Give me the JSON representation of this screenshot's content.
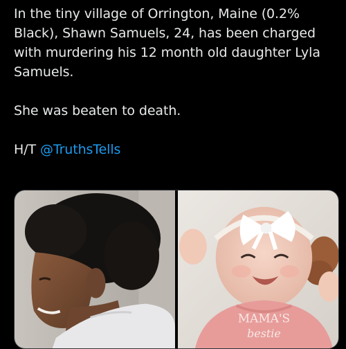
{
  "tweet": {
    "paragraph1": "In the tiny village of Orrington, Maine (0.2% Black), Shawn Samuels, 24, has been charged with murdering his 12 month old daughter Lyla Samuels.",
    "paragraph2": "She was beaten to death.",
    "hat_tip_prefix": "H/T",
    "hat_tip_mention": "@TruthsTells"
  },
  "media": {
    "photo_right": {
      "shirt_text_line1": "MAMA'S",
      "shirt_text_line2": "bestie"
    }
  },
  "colors": {
    "background": "#000000",
    "text": "#e7e9ea",
    "link": "#1d9bf0",
    "border": "#2f3336"
  }
}
